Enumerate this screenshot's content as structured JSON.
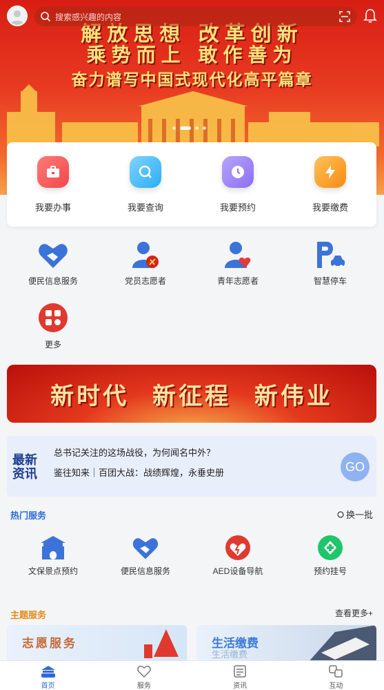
{
  "header": {
    "search_placeholder": "搜索感兴趣的内容"
  },
  "hero": {
    "line1": "解放思想 改革创新",
    "line2": "乘势而上 敢作善为",
    "line3": "奋力谱写中国式现代化高平篇章",
    "slide_count": 4,
    "active_slide": 2
  },
  "main_services": [
    {
      "label": "我要办事",
      "icon": "briefcase-icon",
      "color": "#f2484a"
    },
    {
      "label": "我要查询",
      "icon": "search-icon",
      "color": "#29aef5"
    },
    {
      "label": "我要预约",
      "icon": "clock-icon",
      "color": "#8b6ff0"
    },
    {
      "label": "我要缴费",
      "icon": "lightning-icon",
      "color": "#f99a12"
    }
  ],
  "grid_services": [
    {
      "label": "便民信息服务",
      "icon": "handshake-heart-icon"
    },
    {
      "label": "党员志愿者",
      "icon": "party-volunteer-icon"
    },
    {
      "label": "青年志愿者",
      "icon": "youth-volunteer-icon"
    },
    {
      "label": "智慧停车",
      "icon": "parking-icon"
    },
    {
      "label": "更多",
      "icon": "more-apps-icon"
    }
  ],
  "promo": {
    "text": "新时代 新征程 新伟业"
  },
  "news": {
    "tag_line1": "最新",
    "tag_line2": "资讯",
    "headline1": "总书记关注的这场战役，为何闻名中外？",
    "headline2": "鉴往知来｜百团大战：战绩辉煌，永垂史册",
    "go_label": "GO"
  },
  "hot": {
    "title": "热门服务",
    "refresh_label": "换一批",
    "items": [
      {
        "label": "文保景点预约",
        "icon": "pavilion-icon"
      },
      {
        "label": "便民信息服务",
        "icon": "handshake-heart-icon"
      },
      {
        "label": "AED设备导航",
        "icon": "aed-icon"
      },
      {
        "label": "预约挂号",
        "icon": "medical-cross-icon"
      }
    ]
  },
  "theme": {
    "title": "主题服务",
    "more_label": "查看更多+",
    "card1_title": "志愿服务",
    "card2_title": "生活缴费",
    "card2_subtitle": "生活缴费"
  },
  "tabs": [
    {
      "label": "首页",
      "icon": "home-icon",
      "active": true
    },
    {
      "label": "服务",
      "icon": "heart-service-icon",
      "active": false
    },
    {
      "label": "资讯",
      "icon": "news-icon",
      "active": false
    },
    {
      "label": "互动",
      "icon": "interaction-icon",
      "active": false
    }
  ],
  "colors": {
    "accent_blue": "#2f6bd8",
    "accent_orange": "#e58a18",
    "hero_red": "#d81e14"
  }
}
